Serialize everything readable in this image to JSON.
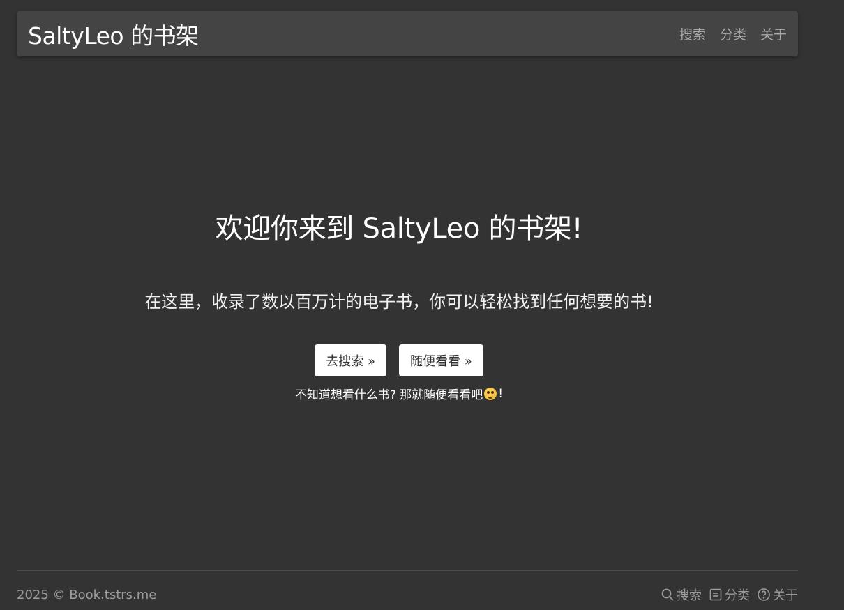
{
  "header": {
    "brand": "SaltyLeo 的书架",
    "nav": [
      {
        "label": "搜索"
      },
      {
        "label": "分类"
      },
      {
        "label": "关于"
      }
    ]
  },
  "hero": {
    "title": "欢迎你来到 SaltyLeo 的书架!",
    "lead": "在这里，收录了数以百万计的电子书，你可以轻松找到任何想要的书!",
    "buttons": {
      "search": "去搜索 »",
      "random": "随便看看 »"
    },
    "hint_before": "不知道想看什么书? 那就随便看看吧",
    "hint_emoji": "zany-face-emoji",
    "hint_after": "!"
  },
  "footer": {
    "copyright": "2025 © Book.tstrs.me",
    "links": [
      {
        "label": "搜索",
        "icon": "search-icon"
      },
      {
        "label": "分类",
        "icon": "list-icon"
      },
      {
        "label": "关于",
        "icon": "question-circle-icon"
      }
    ]
  },
  "colors": {
    "background": "#333333",
    "navbar": "#444444",
    "nav_link": "#a9a9a9",
    "button_bg": "#ffffff",
    "footer_text": "#9c9c9c"
  }
}
